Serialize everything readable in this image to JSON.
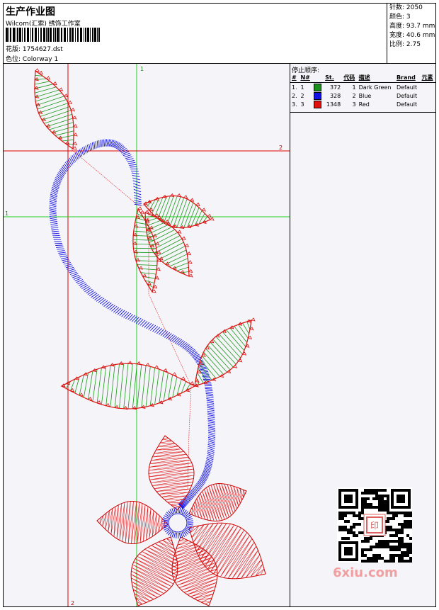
{
  "header": {
    "title": "生产作业图",
    "company": "Wilcom(汇索) 绣饰工作室",
    "design_label": "花版:",
    "design_value": "1754627.dst",
    "colorway_label": "色位:",
    "colorway_value": "Colorway 1"
  },
  "stats": [
    {
      "label": "针数:",
      "value": "2050"
    },
    {
      "label": "颜色:",
      "value": "3"
    },
    {
      "label": "高度:",
      "value": "93.7 mm"
    },
    {
      "label": "宽度:",
      "value": "40.6 mm"
    },
    {
      "label": "比例:",
      "value": "2.75"
    }
  ],
  "guides": {
    "v1": "1",
    "v2": "2",
    "h1": "1",
    "h2": "2"
  },
  "stop_sequence": {
    "heading": "停止顺序:",
    "columns": [
      "#",
      "N#",
      "St.",
      "代码",
      "描述",
      "Brand",
      "元素"
    ],
    "rows": [
      {
        "idx": "1.",
        "n": "1",
        "color": "#1a8f1a",
        "stitches": "372",
        "code": "1",
        "desc": "Dark Green",
        "brand": "Default"
      },
      {
        "idx": "2.",
        "n": "2",
        "color": "#1010e0",
        "stitches": "328",
        "code": "2",
        "desc": "Blue",
        "brand": "Default"
      },
      {
        "idx": "3.",
        "n": "3",
        "color": "#e01010",
        "stitches": "1348",
        "code": "3",
        "desc": "Red",
        "brand": "Default"
      }
    ]
  },
  "watermark": "6xiu.com",
  "qr_stamp": "印"
}
